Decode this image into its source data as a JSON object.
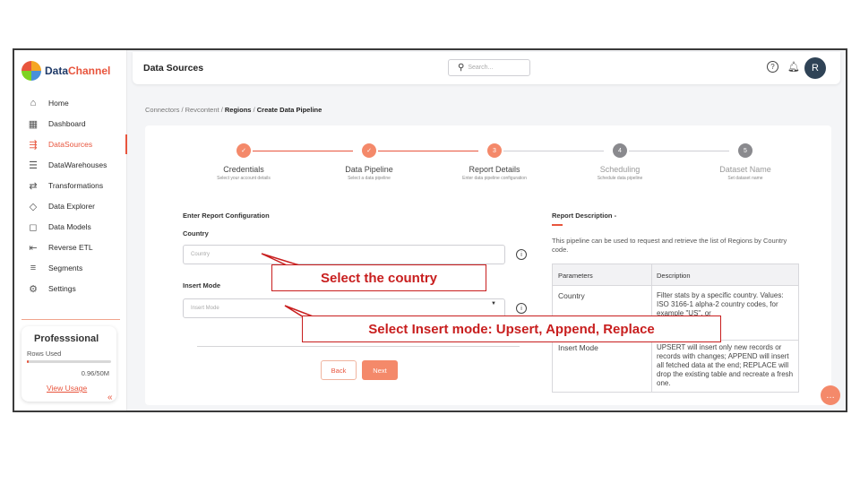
{
  "app": {
    "brand_part1": "Data",
    "brand_part2": "Channel"
  },
  "sidebar": {
    "items": [
      {
        "label": "Home",
        "icon": "home-icon"
      },
      {
        "label": "Dashboard",
        "icon": "dashboard-icon"
      },
      {
        "label": "DataSources",
        "icon": "datasource-icon",
        "active": true
      },
      {
        "label": "DataWarehouses",
        "icon": "database-icon"
      },
      {
        "label": "Transformations",
        "icon": "transform-icon"
      },
      {
        "label": "Data Explorer",
        "icon": "explorer-icon"
      },
      {
        "label": "Data Models",
        "icon": "models-icon"
      },
      {
        "label": "Reverse ETL",
        "icon": "reverse-etl-icon"
      },
      {
        "label": "Segments",
        "icon": "segments-icon"
      },
      {
        "label": "Settings",
        "icon": "gear-icon"
      }
    ],
    "plan": {
      "title": "Professsional",
      "rows_label": "Rows Used",
      "usage": "0.96/50M",
      "usage_fraction": 0.0192,
      "view_usage": "View Usage"
    },
    "collapse_glyph": "«"
  },
  "header": {
    "title": "Data Sources",
    "search_placeholder": "Search...",
    "avatar_initial": "R"
  },
  "breadcrumb": {
    "c1": "Connectors",
    "c2": "Revcontent",
    "c3": "Regions",
    "c4": "Create Data Pipeline",
    "sep": "/"
  },
  "steps": [
    {
      "label": "Credentials",
      "sub": "Select your account details",
      "state": "done"
    },
    {
      "label": "Data Pipeline",
      "sub": "Select a data pipeline",
      "state": "done"
    },
    {
      "label": "Report Details",
      "sub": "Enter data pipeline configuration",
      "state": "current",
      "num": "3"
    },
    {
      "label": "Scheduling",
      "sub": "Schedule data pipeline",
      "state": "pending",
      "num": "4"
    },
    {
      "label": "Dataset Name",
      "sub": "Set dataset name",
      "state": "pending",
      "num": "5"
    }
  ],
  "form": {
    "title": "Enter Report Configuration",
    "country_label": "Country",
    "country_placeholder": "Country",
    "mode_label": "Insert Mode",
    "mode_placeholder": "Insert Mode",
    "back": "Back",
    "next": "Next"
  },
  "description": {
    "title": "Report Description -",
    "text": "This pipeline can be used to request and retrieve the list of Regions by Country code.",
    "col_param": "Parameters",
    "col_desc": "Description",
    "row1_param": "Country",
    "row1_desc": "Filter stats by a specific country. Values: ISO 3166-1 alpha-2 country codes, for example \"US\", or",
    "row2_param": "Insert Mode",
    "row2_desc": "UPSERT will insert only new records or records with changes; APPEND will insert all fetched data at the end; REPLACE will drop the existing table and recreate a fresh one."
  },
  "annotations": {
    "country": "Select the country",
    "mode": "Select Insert mode: Upsert, Append, Replace"
  },
  "colors": {
    "accent": "#e8553d",
    "callout": "#c81e1e",
    "avatar": "#2f4356"
  }
}
